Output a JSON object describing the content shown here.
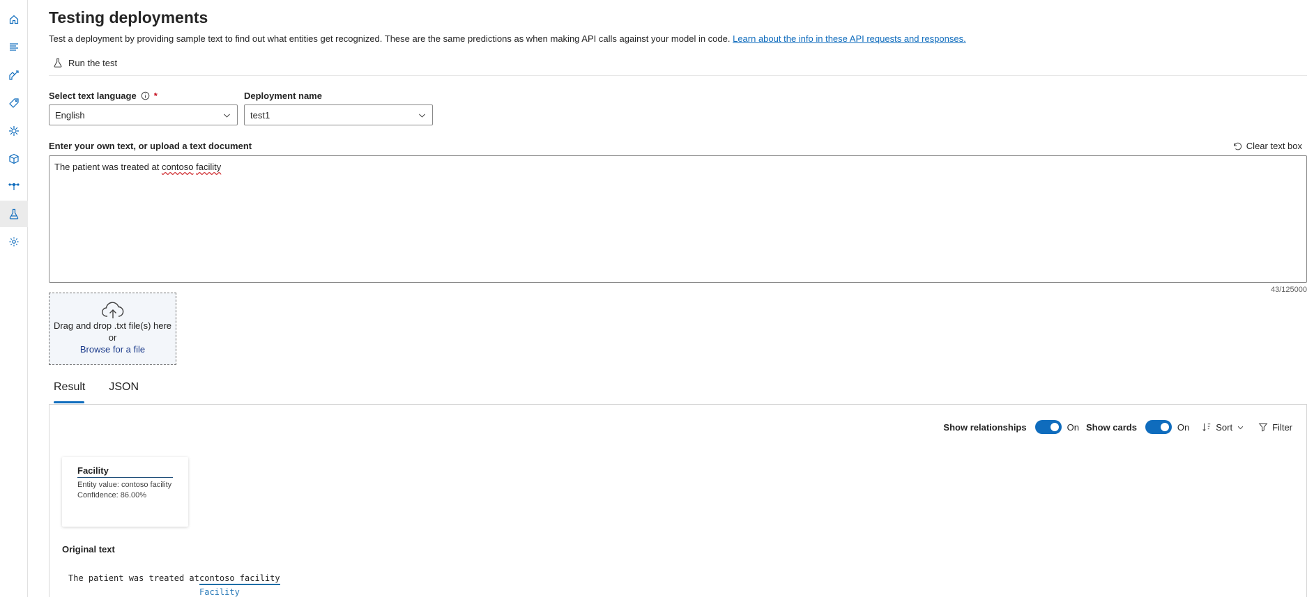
{
  "nav": {
    "items": [
      {
        "icon": "home-icon"
      },
      {
        "icon": "lines-icon"
      },
      {
        "icon": "build-icon"
      },
      {
        "icon": "tag-icon"
      },
      {
        "icon": "model-icon"
      },
      {
        "icon": "cube-icon"
      },
      {
        "icon": "deploy-icon"
      },
      {
        "icon": "flask-icon",
        "active": true
      },
      {
        "icon": "gear-icon"
      }
    ]
  },
  "page": {
    "title": "Testing deployments",
    "description": "Test a deployment by providing sample text to find out what entities get recognized. These are the same predictions as when making API calls against your model in code. ",
    "link_text": "Learn about the info in these API requests and responses."
  },
  "toolbar": {
    "run_label": "Run the test"
  },
  "form": {
    "language_label": "Select text language",
    "language_required": "*",
    "language_value": "English",
    "deployment_label": "Deployment name",
    "deployment_value": "test1",
    "text_label": "Enter your own text, or upload a text document",
    "clear_label": "Clear text box",
    "text_before": "The patient was treated at ",
    "text_word1": "contoso",
    "text_space": " ",
    "text_word2": "facility",
    "counter": "43/125000"
  },
  "upload": {
    "line1": "Drag and drop .txt file(s) here",
    "line2": "or",
    "browse": "Browse for a file"
  },
  "tabs": [
    {
      "label": "Result",
      "active": true
    },
    {
      "label": "JSON",
      "active": false
    }
  ],
  "result": {
    "show_relationships_label": "Show relationships",
    "show_relationships_state": "On",
    "show_cards_label": "Show cards",
    "show_cards_state": "On",
    "sort_label": "Sort",
    "filter_label": "Filter",
    "card": {
      "title": "Facility",
      "entity_value": "Entity value: contoso facility",
      "confidence": "Confidence: 86.00%"
    },
    "original_label": "Original text",
    "original_prefix": "The patient was treated at ",
    "entity_text": "contoso facility",
    "entity_tag": "Facility"
  },
  "colors": {
    "accent": "#0f6cbd",
    "link": "#0f6cbd",
    "required": "#c50f1f",
    "entity_underline": "#1f6fa8"
  }
}
